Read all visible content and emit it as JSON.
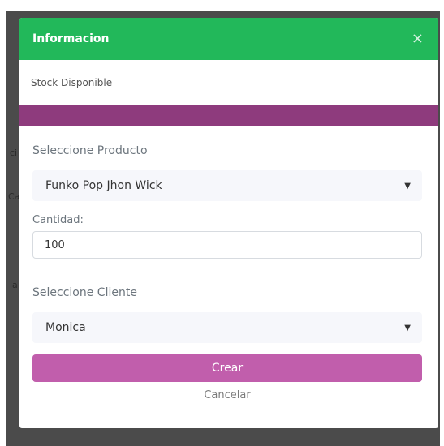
{
  "modal": {
    "title": "Informacion",
    "close_icon": "×",
    "subtitle": "Stock Disponible",
    "accent_color": "#8e3b7d",
    "header_color": "#22b85a"
  },
  "form": {
    "producto_label": "Seleccione Producto",
    "producto_value": "Funko Pop Jhon Wick",
    "cantidad_label": "Cantidad:",
    "cantidad_value": "100",
    "cliente_label": "Seleccione Cliente",
    "cliente_value": "Monica",
    "caret_icon": "▼"
  },
  "actions": {
    "crear_label": "Crear",
    "cancelar_label": "Cancelar",
    "crear_color": "#c15eac"
  },
  "background_fragments": [
    "ci",
    "Ca",
    "la"
  ]
}
